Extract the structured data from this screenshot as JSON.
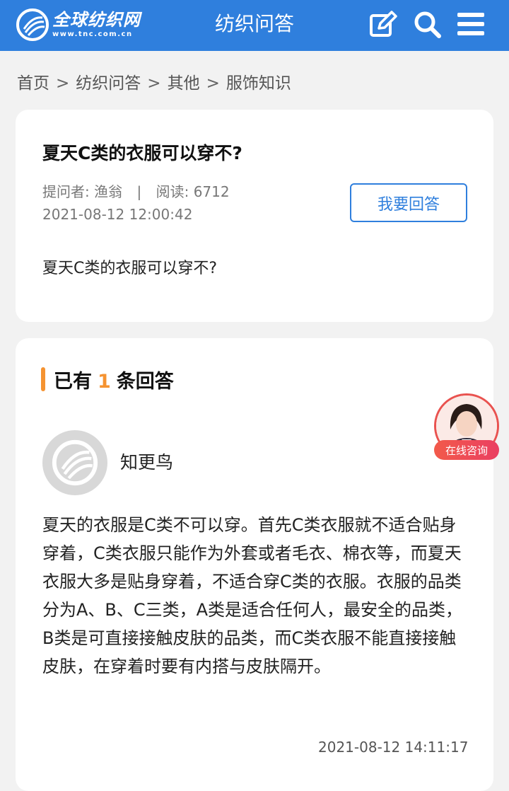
{
  "header": {
    "logo_cn": "全球纺织网",
    "logo_url": "www.tnc.com.cn",
    "title": "纺织问答",
    "icons": [
      "edit-icon",
      "search-icon",
      "menu-icon"
    ]
  },
  "breadcrumb": [
    "首页",
    "纺织问答",
    "其他",
    "服饰知识"
  ],
  "breadcrumb_sep": ">",
  "question": {
    "title": "夏天C类的衣服可以穿不?",
    "asker_label": "提问者:",
    "asker": "渔翁",
    "meta_sep": "|",
    "reads_label": "阅读:",
    "reads": "6712",
    "date": "2021-08-12 12:00:42",
    "answer_button": "我要回答",
    "body": "夏天C类的衣服可以穿不?"
  },
  "answers": {
    "head_prefix": "已有",
    "count": "1",
    "head_suffix": "条回答",
    "items": [
      {
        "username": "知更鸟",
        "body": "夏天的衣服是C类不可以穿。首先C类衣服就不适合贴身穿着，C类衣服只能作为外套或者毛衣、棉衣等，而夏天衣服大多是贴身穿着，不适合穿C类的衣服。衣服的品类分为A、B、C三类，A类是适合任何人，最安全的品类，B类是可直接接触皮肤的品类，而C类衣服不能直接接触皮肤，在穿着时要有内搭与皮肤隔开。",
        "date": "2021-08-12 14:11:17"
      }
    ]
  },
  "consult": {
    "label": "在线咨询"
  },
  "colors": {
    "brand": "#2f7fdd",
    "accent": "#f59331",
    "consult": "#e9524f"
  }
}
